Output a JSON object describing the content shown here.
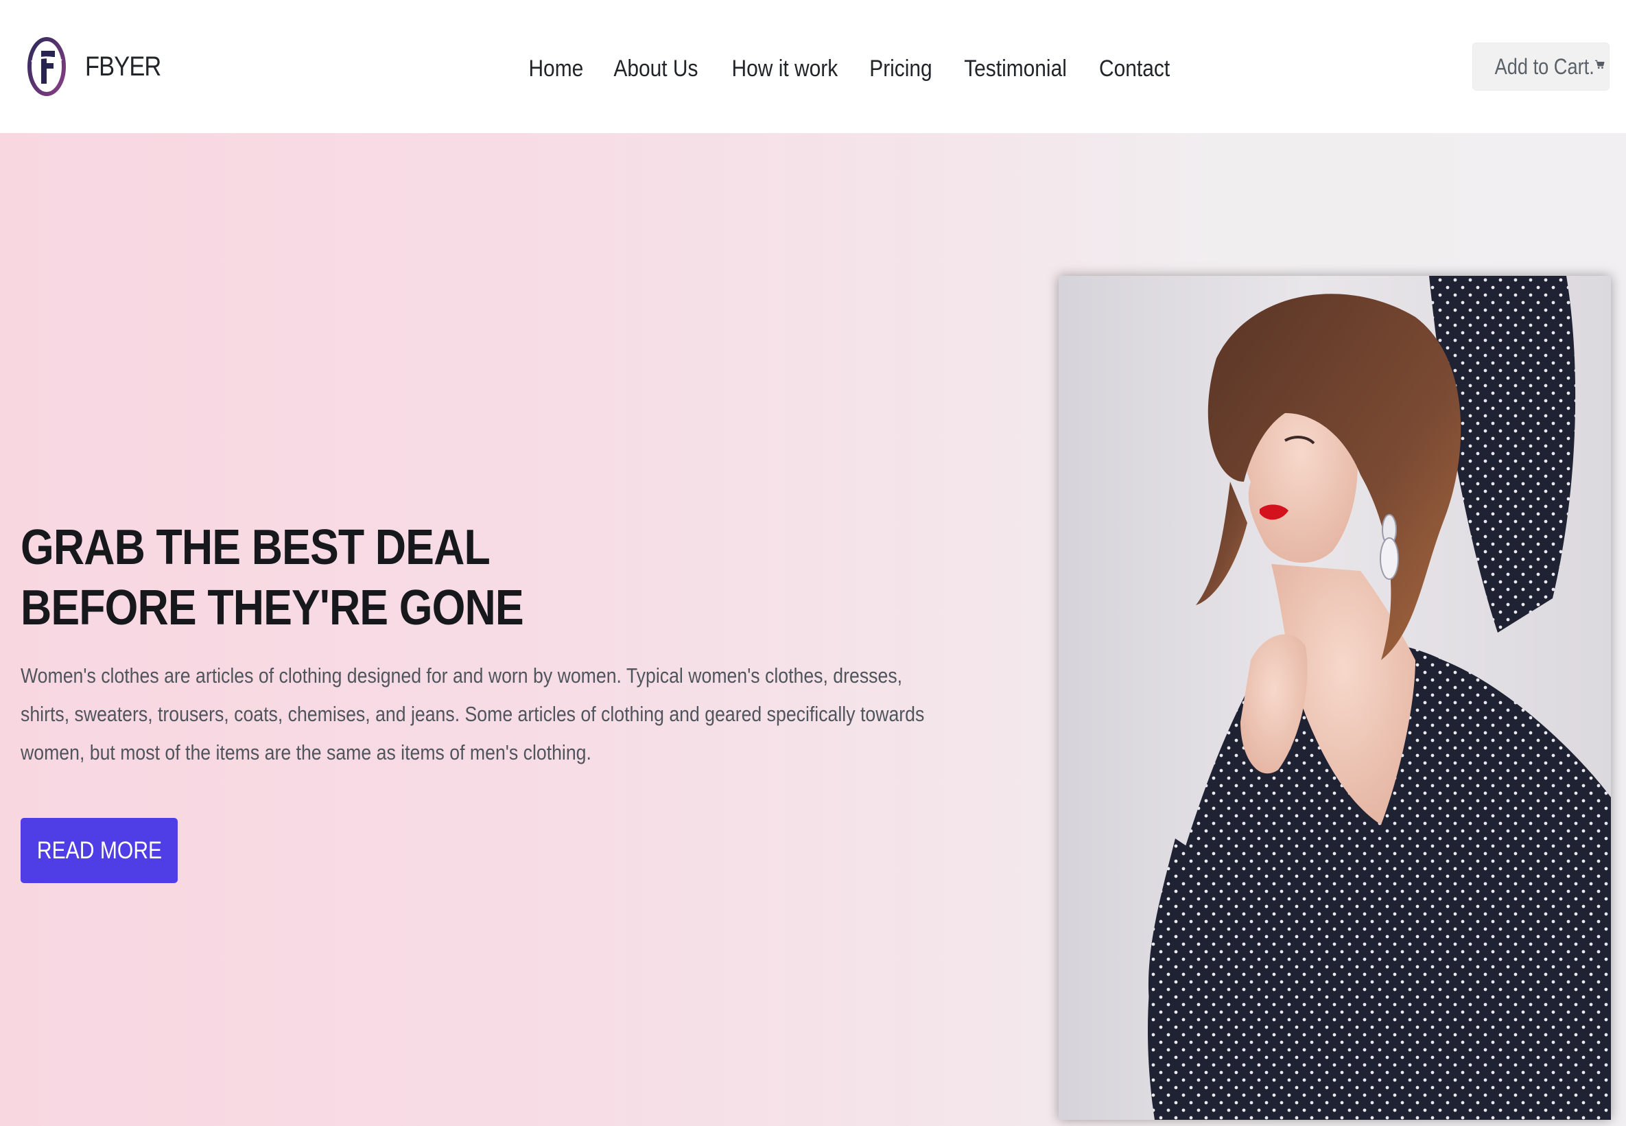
{
  "brand": {
    "name": "FBYER",
    "logo_letter": "F",
    "logo_colors": [
      "#2d2a5a",
      "#7a3a7a"
    ]
  },
  "nav": {
    "items": [
      {
        "label": "Home"
      },
      {
        "label": "About Us"
      },
      {
        "label": "How it work"
      },
      {
        "label": "Pricing"
      },
      {
        "label": "Testimonial"
      },
      {
        "label": "Contact"
      }
    ]
  },
  "cart": {
    "label": "Add to Cart.",
    "icon": "shopping-cart-icon"
  },
  "hero": {
    "title_line1": "GRAB THE BEST DEAL",
    "title_line2": "BEFORE THEY'RE GONE",
    "description": "Women's clothes are articles of clothing designed for and worn by women. Typical women's clothes, dresses, shirts, sweaters, trousers, coats, chemises, and jeans. Some articles of clothing and geared specifically towards women, but most of the items are the same as items of men's clothing.",
    "button_label": "READ MORE",
    "button_color": "#4f3ee6",
    "image": "woman-in-polka-dot-blouse-photo"
  },
  "colors": {
    "hero_gradient_start": "#f8d7e1",
    "hero_gradient_end": "#f1eff1",
    "text_dark": "#16181c",
    "text_muted": "#50555c"
  }
}
